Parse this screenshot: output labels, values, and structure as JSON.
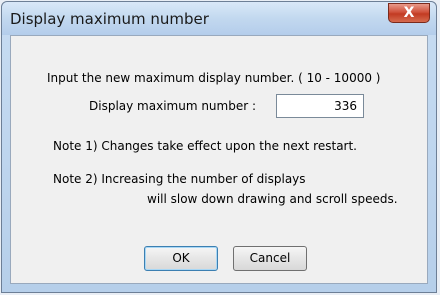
{
  "window": {
    "title": "Display maximum number",
    "close_label": "X"
  },
  "dialog": {
    "instruction": "Input the new maximum display number.  ( 10 - 10000 )",
    "field_label": "Display maximum number  :",
    "field_value": "336",
    "note1": "Note 1)  Changes take effect upon the next restart.",
    "note2_line1": "Note 2)  Increasing the number of displays",
    "note2_line2": "will slow down drawing and scroll speeds."
  },
  "buttons": {
    "ok": "OK",
    "cancel": "Cancel"
  }
}
